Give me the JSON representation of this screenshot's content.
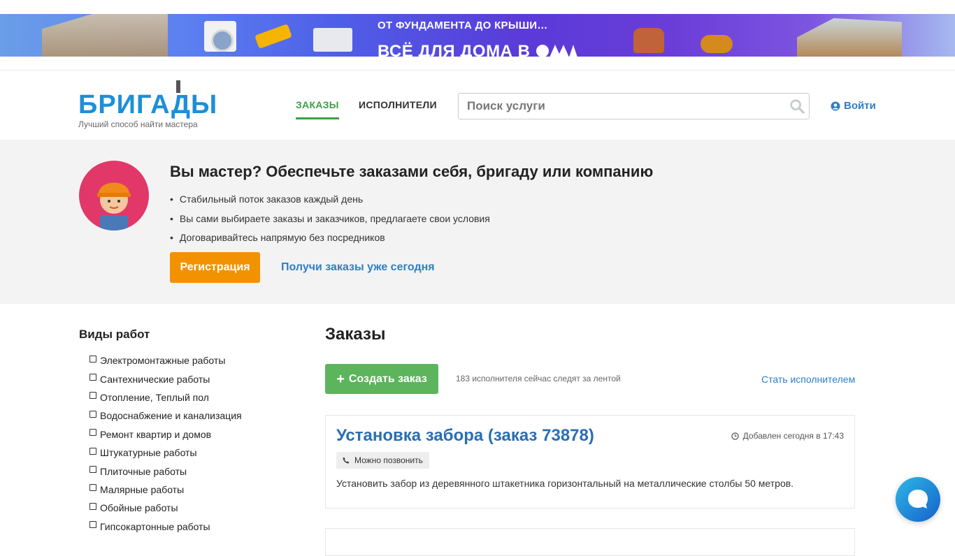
{
  "banner": {
    "title_small": "ОТ ФУНДАМЕНТА ДО КРЫШИ…",
    "title_big": "ВСЁ ДЛЯ ДОМА В"
  },
  "header": {
    "logo_text": "БРИГАДЫ",
    "logo_tagline": "Лучший способ найти мастера",
    "nav": {
      "orders": "ЗАКАЗЫ",
      "executors": "ИСПОЛНИТЕЛИ"
    },
    "search_placeholder": "Поиск услуги",
    "login": "Войти",
    "accent_color": "#3aa046",
    "link_color": "#2f7ec6"
  },
  "promo": {
    "title": "Вы мастер? Обеспечьте заказами себя, бригаду или компанию",
    "bullets": [
      "Стабильный поток заказов каждый день",
      "Вы сами выбираете заказы и заказчиков, предлагаете свои условия",
      "Договаривайтесь напрямую без посредников"
    ],
    "register_button": "Регистрация",
    "link": "Получи заказы уже сегодня",
    "button_color": "#f39200"
  },
  "sidebar": {
    "title": "Виды работ",
    "categories": [
      "Электромонтажные работы",
      "Сантехнические работы",
      "Отопление, Теплый пол",
      "Водоснабжение и канализация",
      "Ремонт квартир и домов",
      "Штукатурные работы",
      "Плиточные работы",
      "Малярные работы",
      "Обойные работы",
      "Гипсокартонные работы"
    ]
  },
  "main": {
    "title": "Заказы",
    "create_button": "Создать заказ",
    "followers": "183 исполнителя сейчас следят за лентой",
    "become_link": "Стать исполнителем",
    "orders": [
      {
        "title": "Установка забора (заказ 73878)",
        "added": "Добавлен сегодня в 17:43",
        "badge": "Можно позвонить",
        "description": "Установить забор из деревянного штакетника горизонтальный на металлические столбы 50 метров."
      }
    ]
  },
  "icons": {
    "search": "search-icon",
    "user": "user-icon",
    "clock": "clock-icon",
    "phone": "phone-icon",
    "chat": "chat-icon"
  }
}
